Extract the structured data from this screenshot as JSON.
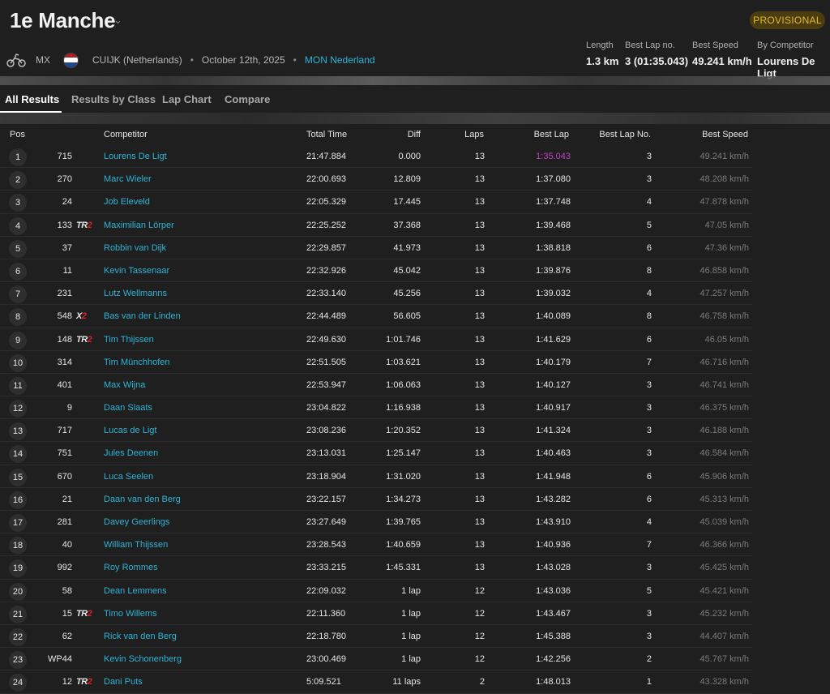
{
  "header": {
    "title": "1e Manche",
    "status": "PROVISIONAL",
    "type": "MX",
    "location": "CUIJK (Netherlands)",
    "date": "October 12th, 2025",
    "organizer": "MON Nederland",
    "dot": "•",
    "stats": [
      {
        "label": "Length",
        "value": "1.3 km"
      },
      {
        "label": "Best Lap no.",
        "value": "3 (01:35.043)"
      },
      {
        "label": "Best Speed",
        "value": "49.241 km/h"
      },
      {
        "label": "By Competitor",
        "value": "Lourens De Ligt"
      }
    ],
    "flag_colors": [
      "#ae1c28",
      "#ffffff",
      "#21468b"
    ]
  },
  "tabs": [
    "All Results",
    "Results by Class",
    "Lap Chart",
    "Compare"
  ],
  "columns": {
    "pos": "Pos",
    "competitor": "Competitor",
    "total_time": "Total Time",
    "diff": "Diff",
    "laps": "Laps",
    "best_lap": "Best Lap",
    "best_lap_no": "Best Lap No.",
    "best_speed": "Best Speed"
  },
  "rows": [
    {
      "pos": "1",
      "num": "715",
      "logo": "",
      "name": "Lourens De Ligt",
      "total": "21:47.884",
      "diff": "0.000",
      "laps": "13",
      "best_lap": "1:35.043",
      "best_lap_no": "3",
      "speed": "49.241 km/h",
      "fastest": true
    },
    {
      "pos": "2",
      "num": "270",
      "logo": "",
      "name": "Marc Wieler",
      "total": "22:00.693",
      "diff": "12.809",
      "laps": "13",
      "best_lap": "1:37.080",
      "best_lap_no": "3",
      "speed": "48.208 km/h"
    },
    {
      "pos": "3",
      "num": "24",
      "logo": "",
      "name": "Job Eleveld",
      "total": "22:05.329",
      "diff": "17.445",
      "laps": "13",
      "best_lap": "1:37.748",
      "best_lap_no": "4",
      "speed": "47.878 km/h"
    },
    {
      "pos": "4",
      "num": "133",
      "logo": "TR2",
      "name": "Maximilian Lörper",
      "total": "22:25.252",
      "diff": "37.368",
      "laps": "13",
      "best_lap": "1:39.468",
      "best_lap_no": "5",
      "speed": "47.05 km/h"
    },
    {
      "pos": "5",
      "num": "37",
      "logo": "",
      "name": "Robbin van Dijk",
      "total": "22:29.857",
      "diff": "41.973",
      "laps": "13",
      "best_lap": "1:38.818",
      "best_lap_no": "6",
      "speed": "47.36 km/h"
    },
    {
      "pos": "6",
      "num": "11",
      "logo": "",
      "name": "Kevin Tassenaar",
      "total": "22:32.926",
      "diff": "45.042",
      "laps": "13",
      "best_lap": "1:39.876",
      "best_lap_no": "8",
      "speed": "46.858 km/h"
    },
    {
      "pos": "7",
      "num": "231",
      "logo": "",
      "name": "Lutz Wellmanns",
      "total": "22:33.140",
      "diff": "45.256",
      "laps": "13",
      "best_lap": "1:39.032",
      "best_lap_no": "4",
      "speed": "47.257 km/h"
    },
    {
      "pos": "8",
      "num": "548",
      "logo": "X2",
      "name": "Bas van der Linden",
      "total": "22:44.489",
      "diff": "56.605",
      "laps": "13",
      "best_lap": "1:40.089",
      "best_lap_no": "8",
      "speed": "46.758 km/h"
    },
    {
      "pos": "9",
      "num": "148",
      "logo": "TR2",
      "name": "Tim Thijssen",
      "total": "22:49.630",
      "diff": "1:01.746",
      "laps": "13",
      "best_lap": "1:41.629",
      "best_lap_no": "6",
      "speed": "46.05 km/h"
    },
    {
      "pos": "10",
      "num": "314",
      "logo": "",
      "name": "Tim Münchhofen",
      "total": "22:51.505",
      "diff": "1:03.621",
      "laps": "13",
      "best_lap": "1:40.179",
      "best_lap_no": "7",
      "speed": "46.716 km/h"
    },
    {
      "pos": "11",
      "num": "401",
      "logo": "",
      "name": "Max Wijna",
      "total": "22:53.947",
      "diff": "1:06.063",
      "laps": "13",
      "best_lap": "1:40.127",
      "best_lap_no": "3",
      "speed": "46.741 km/h"
    },
    {
      "pos": "12",
      "num": "9",
      "logo": "",
      "name": "Daan Slaats",
      "total": "23:04.822",
      "diff": "1:16.938",
      "laps": "13",
      "best_lap": "1:40.917",
      "best_lap_no": "3",
      "speed": "46.375 km/h"
    },
    {
      "pos": "13",
      "num": "717",
      "logo": "",
      "name": "Lucas de Ligt",
      "total": "23:08.236",
      "diff": "1:20.352",
      "laps": "13",
      "best_lap": "1:41.324",
      "best_lap_no": "3",
      "speed": "46.188 km/h"
    },
    {
      "pos": "14",
      "num": "751",
      "logo": "",
      "name": "Jules Deenen",
      "total": "23:13.031",
      "diff": "1:25.147",
      "laps": "13",
      "best_lap": "1:40.463",
      "best_lap_no": "3",
      "speed": "46.584 km/h"
    },
    {
      "pos": "15",
      "num": "670",
      "logo": "",
      "name": "Luca Seelen",
      "total": "23:18.904",
      "diff": "1:31.020",
      "laps": "13",
      "best_lap": "1:41.948",
      "best_lap_no": "6",
      "speed": "45.906 km/h"
    },
    {
      "pos": "16",
      "num": "21",
      "logo": "",
      "name": "Daan van den Berg",
      "total": "23:22.157",
      "diff": "1:34.273",
      "laps": "13",
      "best_lap": "1:43.282",
      "best_lap_no": "6",
      "speed": "45.313 km/h"
    },
    {
      "pos": "17",
      "num": "281",
      "logo": "",
      "name": "Davey Geerlings",
      "total": "23:27.649",
      "diff": "1:39.765",
      "laps": "13",
      "best_lap": "1:43.910",
      "best_lap_no": "4",
      "speed": "45.039 km/h"
    },
    {
      "pos": "18",
      "num": "40",
      "logo": "",
      "name": "William Thijssen",
      "total": "23:28.543",
      "diff": "1:40.659",
      "laps": "13",
      "best_lap": "1:40.936",
      "best_lap_no": "7",
      "speed": "46.366 km/h"
    },
    {
      "pos": "19",
      "num": "992",
      "logo": "",
      "name": "Roy Rommes",
      "total": "23:33.215",
      "diff": "1:45.331",
      "laps": "13",
      "best_lap": "1:43.028",
      "best_lap_no": "3",
      "speed": "45.425 km/h"
    },
    {
      "pos": "20",
      "num": "58",
      "logo": "",
      "name": "Dean Lemmens",
      "total": "22:09.032",
      "diff": "1 lap",
      "laps": "12",
      "best_lap": "1:43.036",
      "best_lap_no": "5",
      "speed": "45.421 km/h"
    },
    {
      "pos": "21",
      "num": "15",
      "logo": "TR2",
      "name": "Timo Willems",
      "total": "22:11.360",
      "diff": "1 lap",
      "laps": "12",
      "best_lap": "1:43.467",
      "best_lap_no": "3",
      "speed": "45.232 km/h"
    },
    {
      "pos": "22",
      "num": "62",
      "logo": "",
      "name": "Rick van den Berg",
      "total": "22:18.780",
      "diff": "1 lap",
      "laps": "12",
      "best_lap": "1:45.388",
      "best_lap_no": "3",
      "speed": "44.407 km/h"
    },
    {
      "pos": "23",
      "num": "WP44",
      "logo": "",
      "name": "Kevin Schonenberg",
      "total": "23:00.469",
      "diff": "1 lap",
      "laps": "12",
      "best_lap": "1:42.256",
      "best_lap_no": "2",
      "speed": "45.767 km/h"
    },
    {
      "pos": "24",
      "num": "12",
      "logo": "TR2",
      "name": "Dani Puts",
      "total": "5:09.521",
      "diff": "11 laps",
      "laps": "2",
      "best_lap": "1:48.013",
      "best_lap_no": "1",
      "speed": "43.328 km/h"
    }
  ]
}
